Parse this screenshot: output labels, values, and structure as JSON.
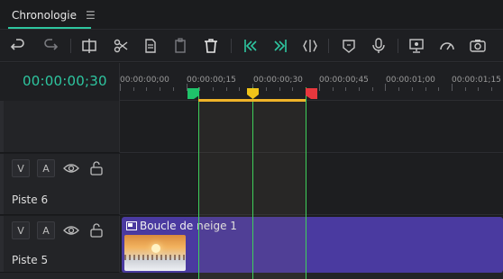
{
  "tab": {
    "title": "Chronologie",
    "menu_glyph": "☰"
  },
  "toolbar": {
    "icons": [
      "undo-icon",
      "redo-icon",
      "split-icon",
      "cut-icon",
      "copy-icon",
      "paste-icon",
      "delete-icon",
      "mark-in-icon",
      "mark-out-icon",
      "fit-icon",
      "marker-icon",
      "mic-icon",
      "monitor-icon",
      "speed-icon",
      "snapshot-icon"
    ]
  },
  "timecode": "00:00:00;30",
  "ruler": {
    "labels": [
      "00:00:00;00",
      "00:00:00;15",
      "00:00:00;30",
      "00:00:00;45",
      "00:00:01;00",
      "00:00:01;15"
    ]
  },
  "tracks": [
    {
      "name": "Piste 6",
      "video_btn": "V",
      "audio_btn": "A"
    },
    {
      "name": "Piste 5",
      "video_btn": "V",
      "audio_btn": "A"
    }
  ],
  "clip": {
    "title": "Boucle de neige 1"
  },
  "colors": {
    "accent": "#2ec6a0",
    "clip": "#4a3aa0",
    "range": "#f0b429",
    "in_marker": "#1fc36a",
    "out_marker": "#e8373d",
    "playhead": "#f0c419"
  }
}
